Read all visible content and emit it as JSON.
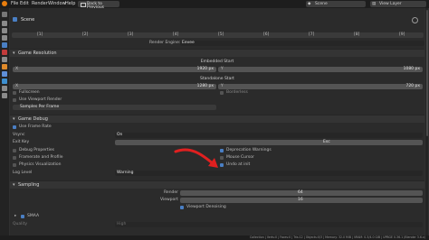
{
  "menu": {
    "items": [
      "File",
      "Edit",
      "Render",
      "Window",
      "Help"
    ],
    "back_button": "Back to Previous",
    "scene": "Scene",
    "view_layer": "View Layer"
  },
  "properties": {
    "context": "Scene",
    "layer_numbers": [
      "[1]",
      "[2]",
      "[3]",
      "[4]",
      "[5]",
      "[6]",
      "[7]",
      "[8]",
      "[9]"
    ],
    "render_engine": {
      "label": "Render Engine:",
      "value": "Eevee"
    }
  },
  "game_resolution": {
    "title": "Game Resolution",
    "embedded_start": "Embedded Start",
    "embedded_x": "X",
    "embedded_x_value": "1920 px",
    "embedded_y": "Y",
    "embedded_y_value": "1080 px",
    "standalone_start": "Standalone Start",
    "standalone_x": "X",
    "standalone_x_value": "1280 px",
    "standalone_y": "Y",
    "standalone_y_value": "720 px",
    "borderless": "Borderless",
    "fullscreen": "Fullscreen",
    "use_viewport_render": "Use Viewport Render",
    "samples_per_frame": "Samples Per Frame"
  },
  "game_debug": {
    "title": "Game Debug",
    "use_frame_rate": "Use Frame Rate",
    "vsync_label": "Vsync",
    "vsync_value": "On",
    "exit_key_label": "Exit Key",
    "exit_key_value": "Esc",
    "debug_properties": "Debug Properties",
    "framerate_profile": "Framerate and Profile",
    "physics_visualization": "Physics Visualization",
    "deprecation_warnings": "Deprecation Warnings",
    "mouse_cursor": "Mouse Cursor",
    "undo_at_init": "Undo at init",
    "log_level_label": "Log Level",
    "log_level_value": "Warning"
  },
  "sampling": {
    "title": "Sampling",
    "render_label": "Render",
    "render_value": "64",
    "viewport_label": "Viewport",
    "viewport_value": "16",
    "viewport_denoising": "Viewport Denoising",
    "smaa": "SMAA",
    "quality_label": "Quality",
    "quality_value": "High"
  },
  "status_bar": {
    "text": "Collection | Verts:0 | Faces:0 | Tris:12 | Objects:0/3 | Memory: 32.0 MiB | VRAM: 0.3/4.0 GiB | UPBGE 0.36.1 (Blender 3.6.x)"
  },
  "colors": {
    "background": "#303030",
    "panel": "#2b2b2b",
    "field": "#545454",
    "checkbox_on": "#4a7fc4",
    "arrow": "#e02020"
  },
  "annotation": {
    "arrow_icon": "red-curved-arrow-icon"
  }
}
